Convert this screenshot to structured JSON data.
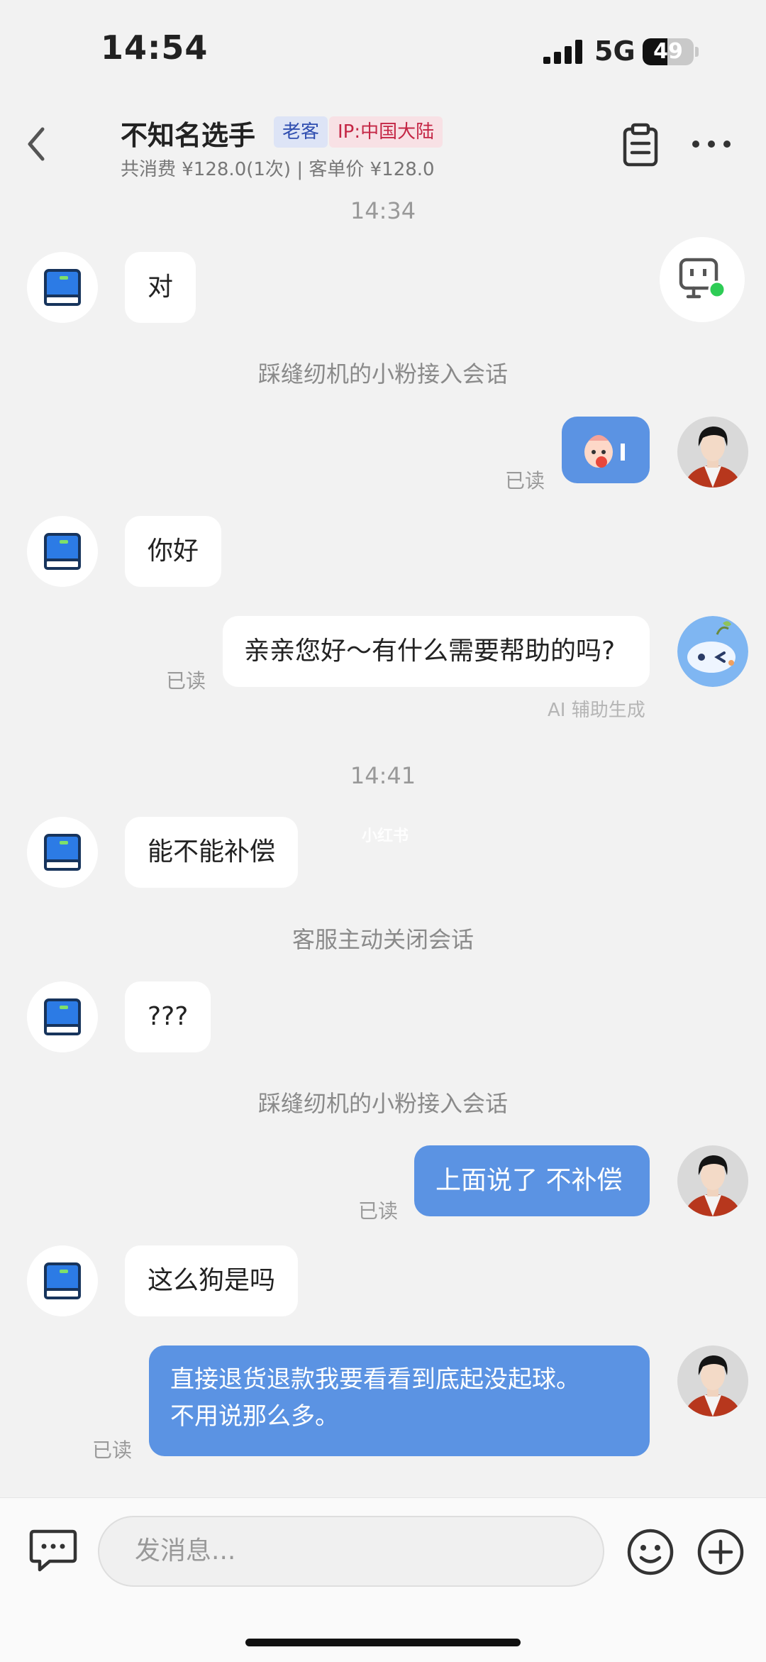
{
  "status_bar": {
    "time": "14:54",
    "network": "5G",
    "battery": "49",
    "battery_level": 0.49
  },
  "header": {
    "name": "不知名选手",
    "tags": [
      "老客",
      "IP:中国大陆"
    ],
    "subtitle": "共消费 ¥128.0(1次) | 客单价 ¥128.0"
  },
  "messages": {
    "ts1": "14:34",
    "m1": "对",
    "sys1": "踩缝纫机的小粉接入会话",
    "read1": "已读",
    "m3": "你好",
    "m4": "亲亲您好～有什么需要帮助的吗?",
    "read2": "已读",
    "ai_note": "AI 辅助生成",
    "ts2": "14:41",
    "m5": "能不能补偿",
    "sys2": "客服主动关闭会话",
    "m6": "???",
    "sys3": "踩缝纫机的小粉接入会话",
    "m7": "上面说了 不补偿",
    "read3": "已读",
    "m8": "这么狗是吗",
    "m9_line1": "直接退货退款我要看看到底起没起球。",
    "m9_line2": "不用说那么多。",
    "read4": "已读"
  },
  "watermark": "小红书",
  "input": {
    "placeholder": "发消息..."
  },
  "colors": {
    "accent": "#5b93e3",
    "background": "#f2f2f2",
    "online": "#2ecc55"
  },
  "icons": [
    "back-icon",
    "clipboard-icon",
    "more-icon",
    "robot-icon",
    "book-icon",
    "chat-icon",
    "emoji-icon",
    "plus-icon"
  ]
}
